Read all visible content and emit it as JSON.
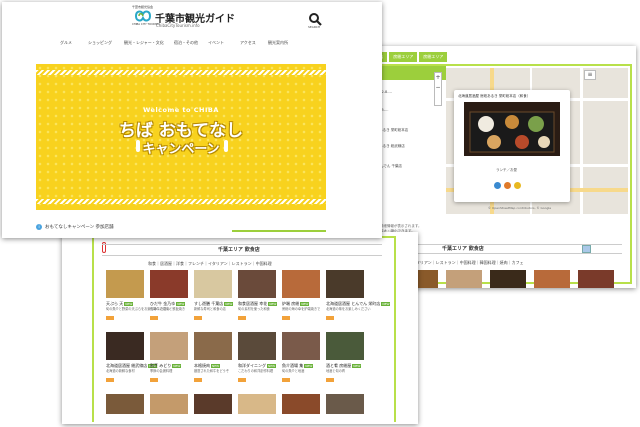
{
  "back_window": {
    "tabs": [
      "千葉エリア 飲食店",
      "房総エリア",
      "房総エリア"
    ],
    "sidebar_title": "マップ",
    "sidebar_rows": [
      "1. (和食)",
      "千葉市中央区富士見2-8-…",
      "2. 創作料理 (和食)",
      "千葉市中央区中央4-5-…",
      "3. 居酒屋 (和食)",
      "北海道居酒屋 房総あるき 栄町総本店",
      "千葉市中央区栄町…",
      "北海道居酒屋 房総あるき 総武線店",
      "千葉市中央区…",
      "4. 北海道居酒屋 とんでん 千葉店",
      "5. 寿司・和食",
      "千葉市中央区…"
    ],
    "zoom_controls": [
      "+",
      "−"
    ],
    "popup_title": "北海道居酒屋 房総あるき 栄町総本店（和食）",
    "popup_caption": "ランチ／お昼",
    "map_copyright": "© OpenStreetMap contributors, © Google",
    "note_lines": [
      "クリックすると、詳細情報が表示されます。",
      "「…」でマップを拡大・縮小できます。"
    ],
    "section_title": "千葉エリア 飲食店",
    "filters": "和食｜居酒屋｜フレンチ｜イタリアン｜レストラン｜中国料理｜韓国料理｜焼肉｜カフェ"
  },
  "middle_window": {
    "section_title": "千葉エリア 飲食店",
    "filters": "和食｜居酒屋｜洋食｜フレンチ｜イタリアン｜レストラン｜中国料理",
    "items": [
      {
        "name": "天ぷら 天",
        "desc": "旬の魚介と野菜の天ぷらをお楽しみください",
        "color": "#c49a4e",
        "badge": "NEW"
      },
      {
        "name": "ひだ牛 金乃ゆ",
        "desc": "飛騨牛の焼肉と鉄板焼き",
        "color": "#8a3a2a",
        "badge": "NEW"
      },
      {
        "name": "すし遊膳 千葉店",
        "desc": "新鮮な寿司と和食の店",
        "color": "#d8c8a0",
        "badge": "NEW"
      },
      {
        "name": "和食居酒屋 幸花",
        "desc": "旬の素材を使った和食",
        "color": "#6a4a3a",
        "badge": "NEW"
      },
      {
        "name": "炉端 房総",
        "desc": "房総の海の幸を炉端焼きで",
        "color": "#b86a3a",
        "badge": "NEW"
      },
      {
        "name": "北海道居酒屋 とんでん 栄町店",
        "desc": "北海道の味をお楽しみください",
        "color": "#4a3a2a",
        "badge": "NEW"
      },
      {
        "name": "北海道居酒屋 総武線店",
        "desc": "北海道の新鮮な食材",
        "color": "#3a2a22",
        "badge": "NEW"
      },
      {
        "name": "割烹 みどり",
        "desc": "季節の会席料理",
        "color": "#c4a07a",
        "badge": "NEW"
      },
      {
        "name": "本格焼肉",
        "desc": "厳選された和牛をどうぞ",
        "color": "#8a6a4a",
        "badge": "NEW"
      },
      {
        "name": "和洋ダイニング",
        "desc": "こだわりの和洋創作料理",
        "color": "#5a4a3a",
        "badge": "NEW"
      },
      {
        "name": "魚介酒場 集",
        "desc": "旬の魚介と地酒",
        "color": "#7a5a4a",
        "badge": "NEW"
      },
      {
        "name": "酒と肴 房総屋",
        "desc": "地酒と旬の肴",
        "color": "#4a5a3a",
        "badge": "NEW"
      }
    ]
  },
  "front_window": {
    "logo_top": "千葉市観光協会",
    "logo_bottom": "CHIBA CITY TOURISM",
    "site_title": "千葉市観光ガイド",
    "site_subtitle": "ChibaCityTourism.info",
    "search_label": "SEARCH",
    "nav": [
      "グルメ",
      "ショッピング",
      "観光・レジャー・文化",
      "宿泊・その他",
      "イベント",
      "アクセス",
      "観光案内所"
    ],
    "hero_welcome": "Welcome to CHIBA",
    "hero_main": "ちば おもてなし",
    "hero_sub": "キャンペーン",
    "footer_text": "おもてなしキャンペーン 参加店舗"
  },
  "colors": {
    "brand_green": "#9ccf3c",
    "hero_yellow": "#f8d21e",
    "tag_orange": "#f2a23a"
  }
}
